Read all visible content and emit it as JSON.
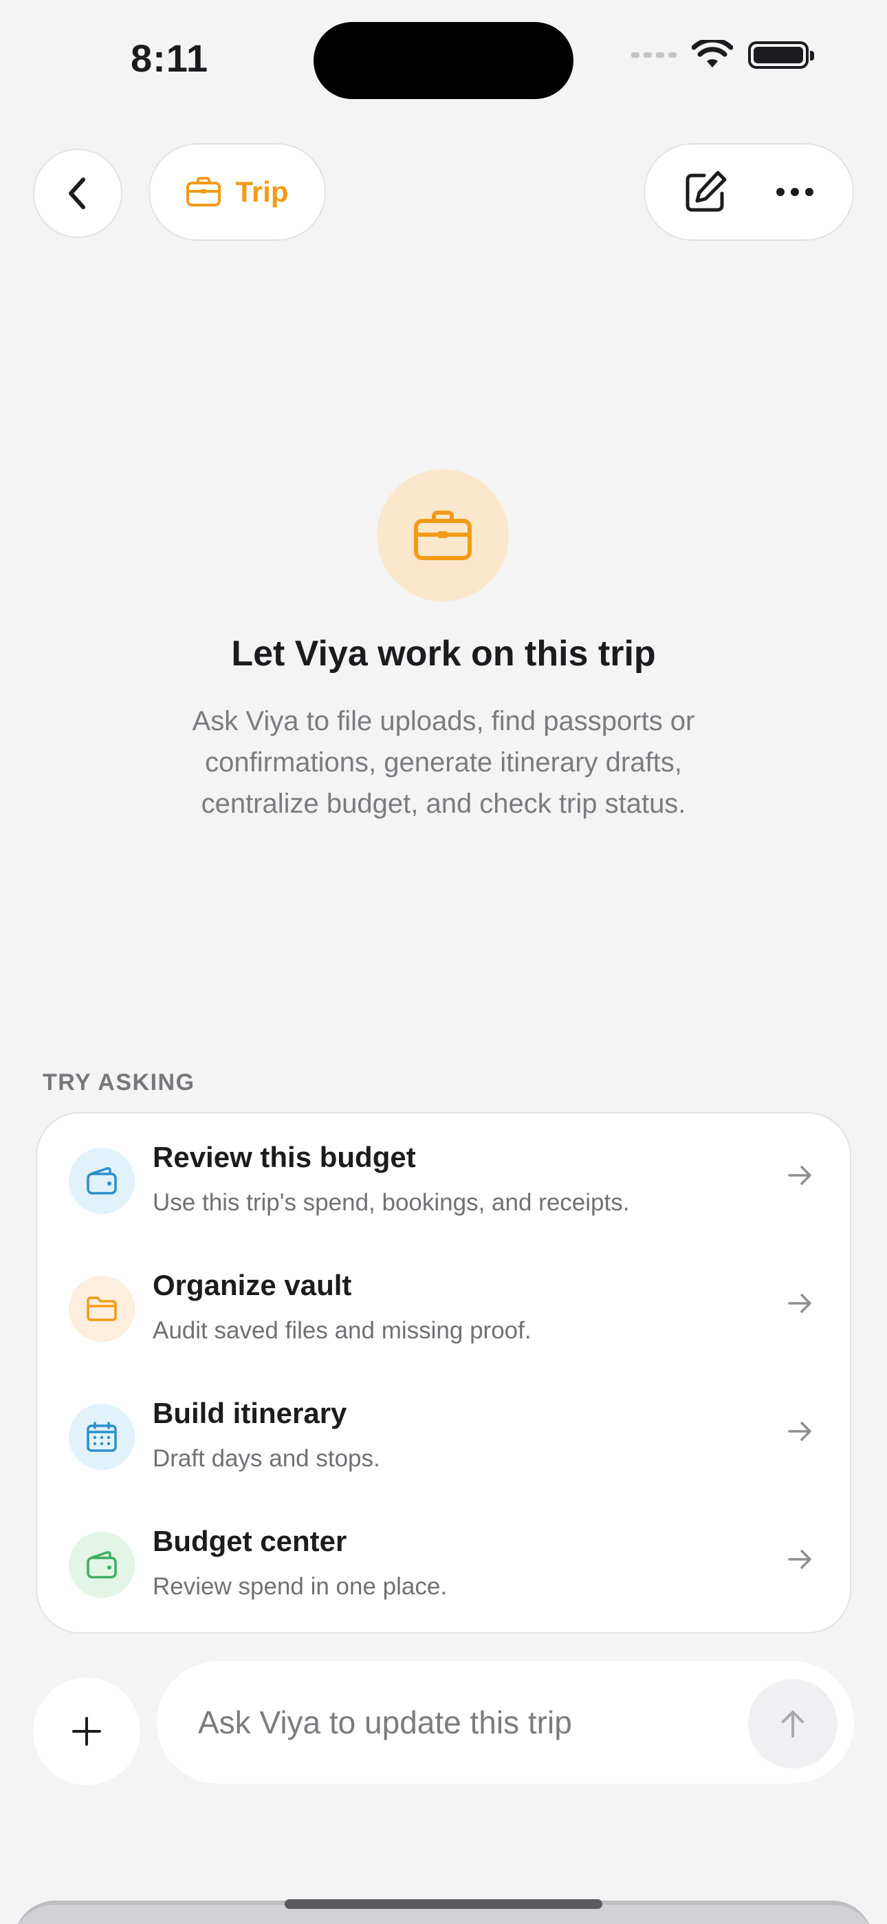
{
  "status_bar": {
    "time": "8:11"
  },
  "header": {
    "back_icon": "chevron-left-icon",
    "chip_label": "Trip",
    "chip_icon": "briefcase-icon",
    "accent_color": "#f29b17",
    "edit_icon": "compose-icon",
    "more_icon": "ellipsis-icon"
  },
  "hero": {
    "icon": "briefcase-icon",
    "title": "Let Viya work on this trip",
    "description": "Ask Viya to file uploads, find passports or confirmations, generate itinerary drafts, centralize budget, and check trip status."
  },
  "suggestions": {
    "label": "TRY ASKING",
    "items": [
      {
        "title": "Review this budget",
        "subtitle": "Use this trip's spend, bookings, and receipts.",
        "icon": "wallet-icon",
        "color": "#2b8fc9",
        "bg": "#e1f2fb"
      },
      {
        "title": "Organize vault",
        "subtitle": "Audit saved files and missing proof.",
        "icon": "folder-icon",
        "color": "#f29b17",
        "bg": "#fdeedd"
      },
      {
        "title": "Build itinerary",
        "subtitle": "Draft days and stops.",
        "icon": "calendar-icon",
        "color": "#2b8fc9",
        "bg": "#e1f2fb"
      },
      {
        "title": "Budget center",
        "subtitle": "Review spend in one place.",
        "icon": "wallet-icon",
        "color": "#3fae5c",
        "bg": "#e3f5e7"
      }
    ]
  },
  "composer": {
    "placeholder": "Ask Viya to update this trip",
    "add_icon": "plus-icon",
    "send_icon": "arrow-up-icon"
  }
}
